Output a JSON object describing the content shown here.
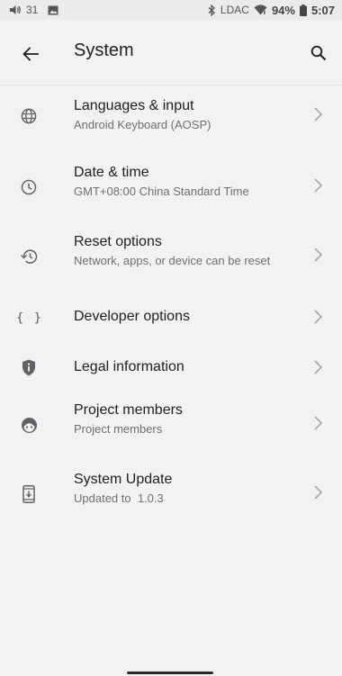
{
  "status_bar": {
    "volume_level": "31",
    "bt_codec": "LDAC",
    "battery": "94%",
    "time": "5:07",
    "icons": [
      "volume-icon",
      "image-icon",
      "bluetooth-icon",
      "wifi-icon",
      "battery-icon"
    ]
  },
  "app_bar": {
    "title": "System",
    "back_icon": "arrow-back-icon",
    "search_icon": "search-icon"
  },
  "items": [
    {
      "icon": "globe-icon",
      "title": "Languages & input",
      "subtitle": "Android Keyboard (AOSP)"
    },
    {
      "icon": "clock-icon",
      "title": "Date & time",
      "subtitle": "GMT+08:00 China Standard Time"
    },
    {
      "icon": "history-icon",
      "title": "Reset options",
      "subtitle": "Network, apps, or device can be reset"
    },
    {
      "icon": "braces-icon",
      "icon_text": "{ }",
      "title": "Developer options",
      "subtitle": ""
    },
    {
      "icon": "shield-info-icon",
      "title": "Legal information",
      "subtitle": ""
    },
    {
      "icon": "face-icon",
      "title": "Project members",
      "subtitle": "Project members"
    },
    {
      "icon": "system-update-icon",
      "title": "System Update",
      "subtitle": "Updated to  1.0.3"
    }
  ],
  "colors": {
    "background": "#f2f2f2",
    "status_bar": "#ebebeb",
    "text_primary": "#202124",
    "text_secondary": "#6f6f6f",
    "icon": "#5f6368"
  }
}
